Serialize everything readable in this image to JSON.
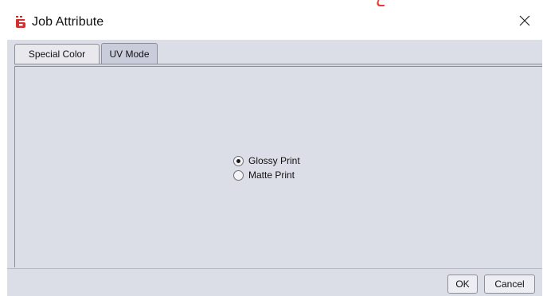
{
  "window": {
    "title": "Job Attribute",
    "icon": "app-logo-icon",
    "close_icon": "close-icon",
    "accent_color": "#e53935"
  },
  "tabs": [
    {
      "label": "Special Color",
      "selected": false
    },
    {
      "label": "UV Mode",
      "selected": true
    }
  ],
  "uv_mode": {
    "options": [
      {
        "label": "Glossy Print",
        "checked": true
      },
      {
        "label": "Matte Print",
        "checked": false
      }
    ]
  },
  "buttons": {
    "ok_label": "OK",
    "cancel_label": "Cancel"
  }
}
